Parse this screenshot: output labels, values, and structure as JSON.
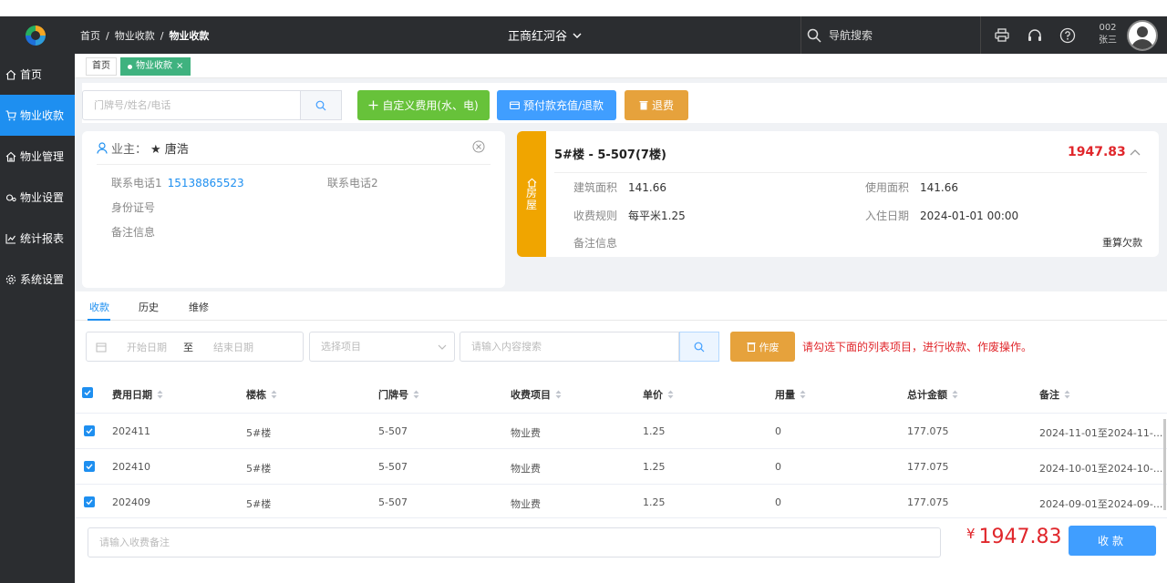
{
  "header": {
    "breadcrumb": [
      "首页",
      "物业收款",
      "物业收款"
    ],
    "project": "正商红河谷",
    "nav_search_placeholder": "导航搜索",
    "user_code": "002",
    "user_name": "张三"
  },
  "sidebar": {
    "items": [
      {
        "label": "首页",
        "icon": "home-icon",
        "active": false
      },
      {
        "label": "物业收款",
        "icon": "cart-icon",
        "active": true
      },
      {
        "label": "物业管理",
        "icon": "house-icon",
        "active": false
      },
      {
        "label": "物业设置",
        "icon": "settings-icon",
        "active": false
      },
      {
        "label": "统计报表",
        "icon": "chart-icon",
        "active": false
      },
      {
        "label": "系统设置",
        "icon": "gear-icon",
        "active": false
      }
    ]
  },
  "tabs": {
    "home": "首页",
    "active": "物业收款"
  },
  "toolbar": {
    "search_placeholder": "门牌号/姓名/电话",
    "custom_fee": "自定义费用(水、电)",
    "prepay": "预付款充值/退款",
    "refund": "退费"
  },
  "owner": {
    "label": "业主：",
    "name": "★ 唐浩",
    "phone1_label": "联系电话1",
    "phone1": "15138865523",
    "phone2_label": "联系电话2",
    "id_label": "身份证号",
    "note_label": "备注信息"
  },
  "house": {
    "tag": [
      "房",
      "屋"
    ],
    "title": "5#楼 - 5-507(7楼)",
    "amount": "1947.83",
    "build_area_label": "建筑面积",
    "build_area": "141.66",
    "use_area_label": "使用面积",
    "use_area": "141.66",
    "rule_label": "收费规则",
    "rule": "每平米1.25",
    "checkin_label": "入住日期",
    "checkin": "2024-01-01 00:00",
    "note_label": "备注信息",
    "recalc": "重算欠款"
  },
  "subtabs": [
    "收款",
    "历史",
    "维修"
  ],
  "filter": {
    "start_placeholder": "开始日期",
    "to": "至",
    "end_placeholder": "结束日期",
    "select_placeholder": "选择项目",
    "content_placeholder": "请输入内容搜索",
    "void": "作废",
    "hint": "请勾选下面的列表项目，进行收款、作废操作。"
  },
  "table": {
    "columns": [
      "费用日期",
      "楼栋",
      "门牌号",
      "收费项目",
      "单价",
      "用量",
      "总计金额",
      "备注"
    ],
    "rows": [
      [
        "202411",
        "5#楼",
        "5-507",
        "物业费",
        "1.25",
        "0",
        "177.075",
        "2024-11-01至2024-11-..."
      ],
      [
        "202410",
        "5#楼",
        "5-507",
        "物业费",
        "1.25",
        "0",
        "177.075",
        "2024-10-01至2024-10-..."
      ],
      [
        "202409",
        "5#楼",
        "5-507",
        "物业费",
        "1.25",
        "0",
        "177.075",
        "2024-09-01至2024-09-..."
      ]
    ]
  },
  "footer": {
    "note_placeholder": "请输入收费备注",
    "currency": "¥",
    "total": "1947.83",
    "pay": "收款"
  },
  "colors": {
    "accent": "#1e8ff0",
    "topbar": "#2b2d30",
    "green": "#67c23a",
    "orange": "#e6a23c",
    "red": "#e0262b"
  }
}
